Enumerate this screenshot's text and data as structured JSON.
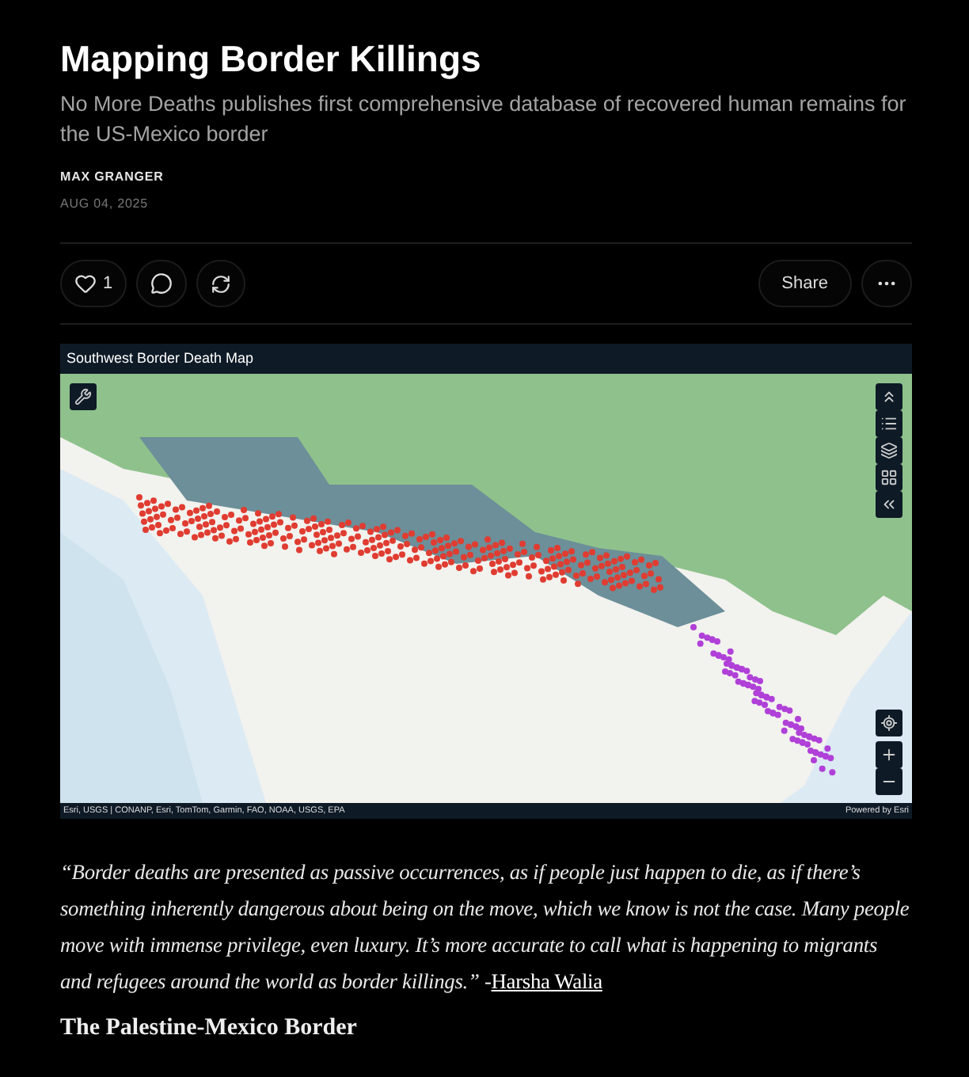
{
  "post": {
    "title": "Mapping Border Killings",
    "subtitle": "No More Deaths publishes first comprehensive database of recovered human remains for the US-Mexico border",
    "author": "MAX GRANGER",
    "date": "AUG 04, 2025"
  },
  "actions": {
    "like_count": "1",
    "share": "Share"
  },
  "map": {
    "title": "Southwest Border Death Map",
    "attribution": "Esri, USGS | CONANP, Esri, TomTom, Garmin, FAO, NOAA, USGS, EPA",
    "powered_by": "Powered by Esri"
  },
  "quote": {
    "text": "“Border deaths are presented as passive occurrences, as if people just happen to die, as if there’s something inherently dangerous about being on the move, which we know is not the case. Many people move with immense privilege, even luxury. It’s more accurate to call what is happening to migrants and refugees around the world as border killings.” -",
    "link": "Harsha Walia"
  },
  "section_heading": "The Palestine-Mexico Border"
}
